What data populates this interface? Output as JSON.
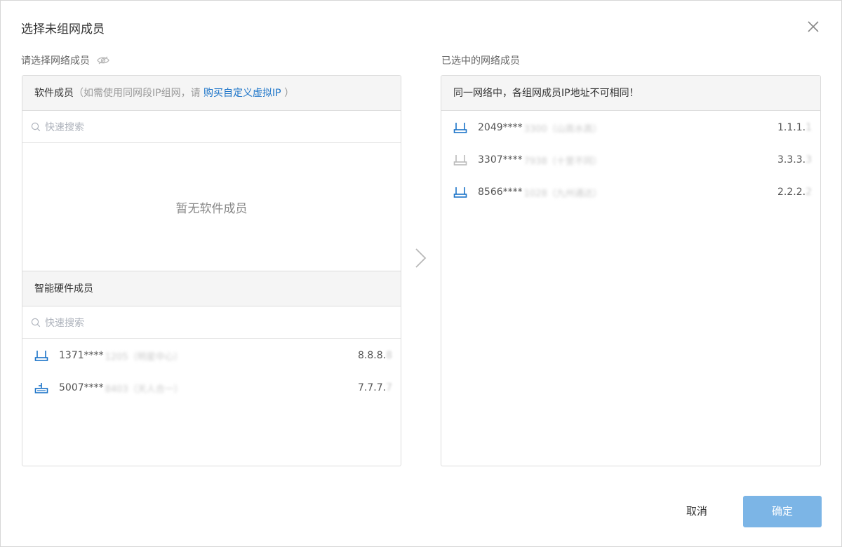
{
  "dialog": {
    "title": "选择未组网成员",
    "close_icon": "close-icon"
  },
  "left": {
    "label": "请选择网络成员",
    "label_icon": "eye-icon",
    "software": {
      "header_title": "软件成员",
      "header_hint_prefix": "（如需使用同网段IP组网，请",
      "header_link": "购买自定义虚拟IP",
      "header_hint_suffix": "）",
      "search_placeholder": "快速搜索",
      "empty_text": "暂无软件成员"
    },
    "hardware": {
      "header_title": "智能硬件成员",
      "search_placeholder": "快速搜索",
      "items": [
        {
          "id": "1371****",
          "blur": "1205（明星中心）",
          "ip_main": "8.8.8.",
          "ip_tail": "8",
          "icon": "router-icon",
          "color": "#1a73c8"
        },
        {
          "id": "5007****",
          "blur": "8403（天人合一）",
          "ip_main": "7.7.7.",
          "ip_tail": "7",
          "icon": "router-icon",
          "color": "#1a73c8"
        }
      ]
    }
  },
  "transfer": {
    "icon": "chevron-right-icon"
  },
  "right": {
    "label": "已选中的网络成员",
    "header_warning": "同一网络中，各组网成员IP地址不可相同！",
    "items": [
      {
        "id": "2049****",
        "blur": "3300（山高水高）",
        "ip_main": "1.1.1.",
        "ip_tail": "1",
        "icon": "router-icon",
        "color": "#1a73c8"
      },
      {
        "id": "3307****",
        "blur": "7938（十里不同）",
        "ip_main": "3.3.3.",
        "ip_tail": "3",
        "icon": "router-icon",
        "color": "#bbbbbb"
      },
      {
        "id": "8566****",
        "blur": "1028（九州通达）",
        "ip_main": "2.2.2.",
        "ip_tail": "2",
        "icon": "router-icon",
        "color": "#1a73c8"
      }
    ]
  },
  "footer": {
    "cancel_label": "取消",
    "confirm_label": "确定"
  },
  "colors": {
    "accent": "#1a73c8",
    "confirm_disabled": "#7cb5e6",
    "panel_header_bg": "#f5f5f5"
  }
}
